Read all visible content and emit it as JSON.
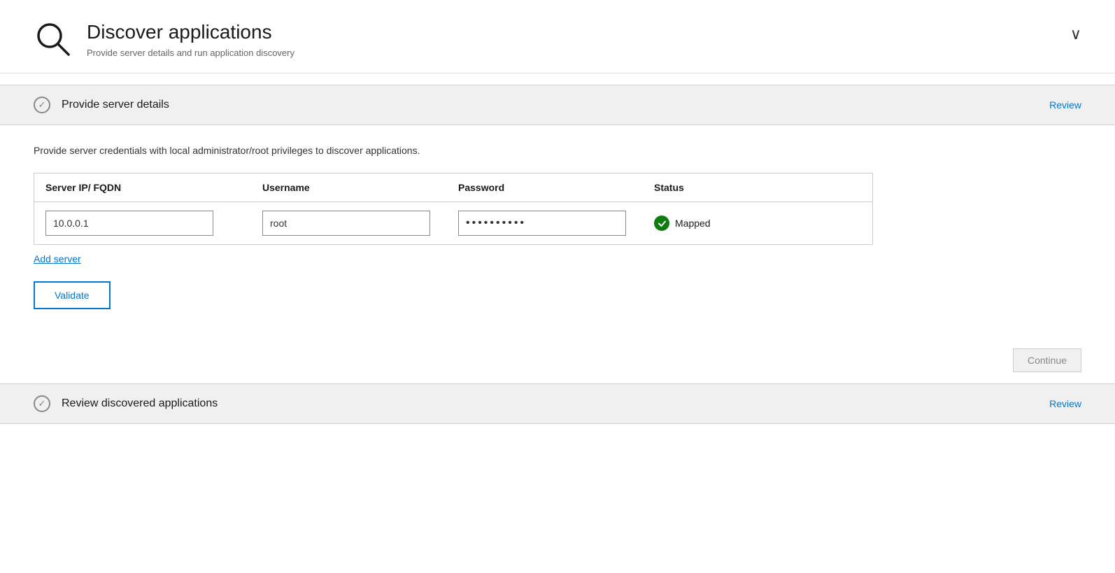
{
  "header": {
    "title": "Discover applications",
    "subtitle": "Provide server details and run application discovery",
    "chevron_label": "∨"
  },
  "section1": {
    "check_symbol": "✓",
    "title": "Provide server details",
    "review_label": "Review",
    "description": "Provide server credentials with local administrator/root privileges to discover applications.",
    "table": {
      "columns": [
        "Server IP/ FQDN",
        "Username",
        "Password",
        "Status"
      ],
      "rows": [
        {
          "server_ip": "10.0.0.1",
          "username": "root",
          "password": "••••••••••",
          "status": "Mapped"
        }
      ]
    },
    "add_server_label": "Add server",
    "validate_label": "Validate",
    "continue_label": "Continue"
  },
  "section2": {
    "check_symbol": "✓",
    "title": "Review discovered applications",
    "review_label": "Review"
  }
}
